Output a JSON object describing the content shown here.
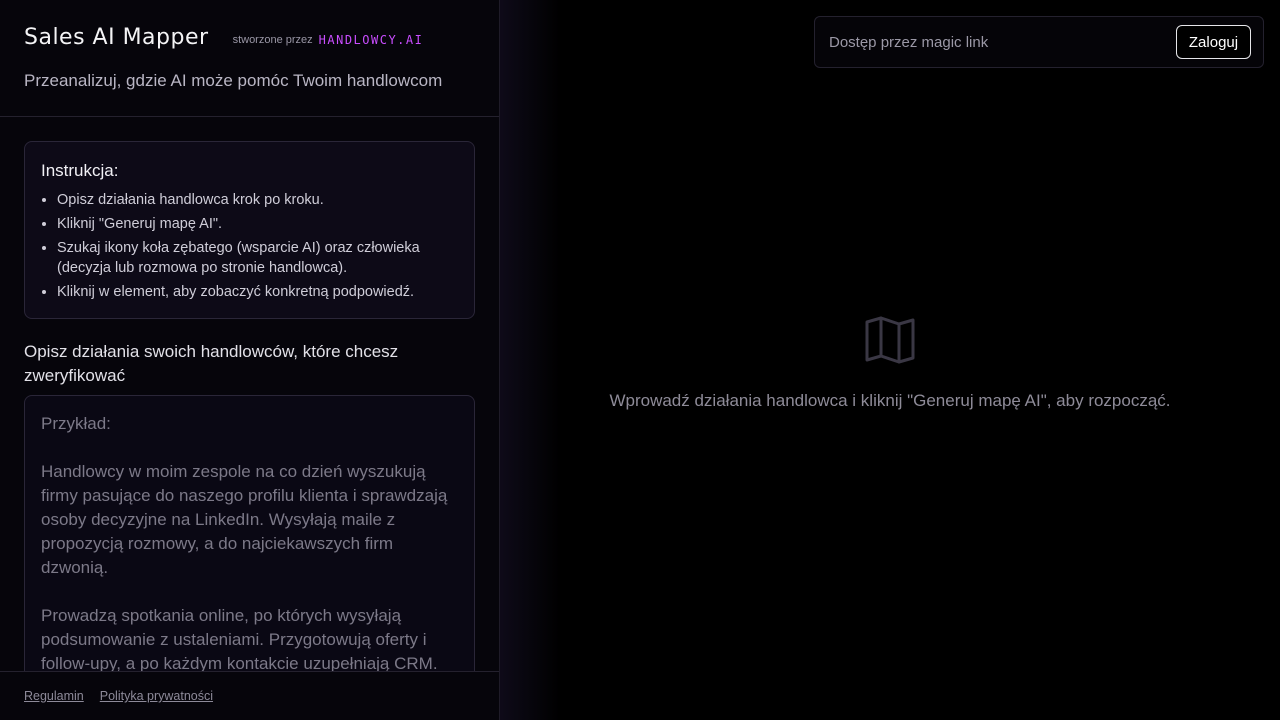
{
  "header": {
    "app_title": "Sales AI Mapper",
    "created_by": "stworzone przez",
    "brand": "HANDLOWCY.AI",
    "subtitle": "Przeanalizuj, gdzie AI może pomóc Twoim handlowcom"
  },
  "instructions": {
    "title": "Instrukcja:",
    "items": [
      "Opisz działania handlowca krok po kroku.",
      "Kliknij \"Generuj mapę AI\".",
      "Szukaj ikony koła zębatego (wsparcie AI) oraz człowieka (decyzja lub rozmowa po stronie handlowca).",
      "Kliknij w element, aby zobaczyć konkretną podpowiedź."
    ]
  },
  "form": {
    "label": "Opisz działania swoich handlowców, które chcesz zweryfikować",
    "placeholder": "Przykład:\n\nHandlowcy w moim zespole na co dzień wyszukują firmy pasujące do naszego profilu klienta i sprawdzają osoby decyzyjne na LinkedIn. Wysyłają maile z propozycją rozmowy, a do najciekawszych firm dzwonią.\n\nProwadzą spotkania online, po których wysyłają podsumowanie z ustaleniami. Przygotowują oferty i follow-upy, a po każdym kontakcie uzupełniają CRM.",
    "value": ""
  },
  "footer": {
    "terms": "Regulamin",
    "privacy": "Polityka prywatności"
  },
  "auth": {
    "placeholder": "Dostęp przez magic link",
    "login_label": "Zaloguj"
  },
  "empty_state": {
    "icon": "map-icon",
    "text": "Wprowadź działania handlowca i kliknij \"Generuj mapę AI\", aby rozpocząć."
  },
  "colors": {
    "brand_accent": "#c94dff",
    "background": "#000000",
    "panel": "#06050b"
  }
}
